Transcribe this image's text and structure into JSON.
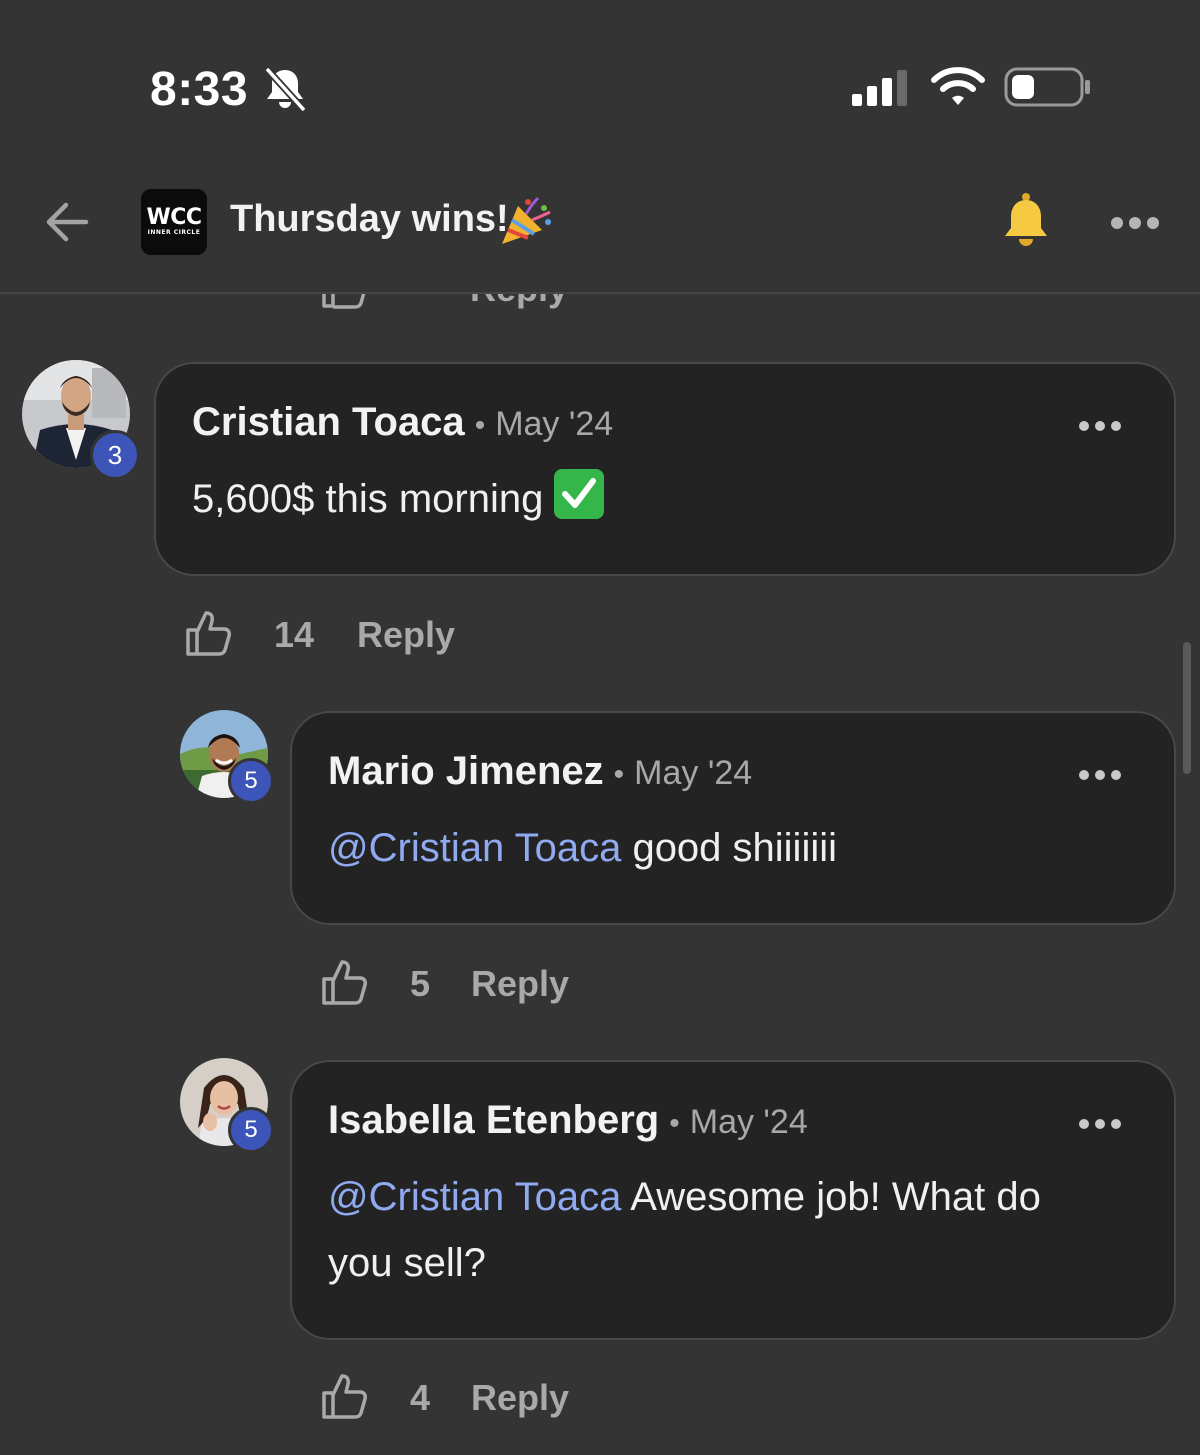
{
  "status_bar": {
    "time": "8:33"
  },
  "header": {
    "logo_line1": "WCC",
    "logo_line2": "INNER CIRCLE",
    "title": "Thursday wins!"
  },
  "comments": [
    {
      "name": "Cristian Toaca",
      "separator": "•",
      "date": "May '24",
      "level": "3",
      "text": "5,600$ this morning",
      "likes": "14",
      "reply_label": "Reply"
    },
    {
      "name": "Mario Jimenez",
      "separator": "•",
      "date": "May '24",
      "level": "5",
      "mention": "@Cristian Toaca",
      "text": " good shiiiiiii",
      "likes": "5",
      "reply_label": "Reply"
    },
    {
      "name": "Isabella Etenberg",
      "separator": "•",
      "date": "May '24",
      "level": "5",
      "mention": "@Cristian Toaca",
      "text_line1": " Awesome job! What do",
      "text_line2": "you sell?",
      "likes": "4",
      "reply_label": "Reply"
    }
  ],
  "colors": {
    "background": "#343434",
    "bubble": "#232323",
    "mention": "#8faaf0",
    "badge": "#3d55b8",
    "bell": "#f6c943"
  },
  "icons": [
    "bell-off-icon",
    "signal-icon",
    "wifi-icon",
    "battery-icon",
    "back-arrow-icon",
    "party-popper-icon",
    "bell-icon",
    "more-icon",
    "thumbs-up-icon",
    "check-mark-icon"
  ]
}
